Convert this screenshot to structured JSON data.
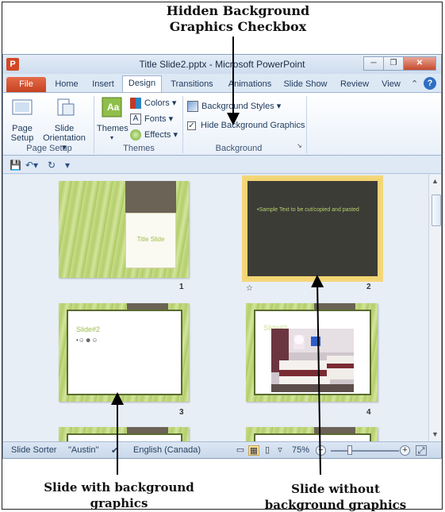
{
  "annotations": {
    "top": "Hidden Background\nGraphics Checkbox",
    "bottom_left": "Slide with background\ngraphics",
    "bottom_right": "Slide without\nbackground graphics"
  },
  "window": {
    "title": "Title Slide2.pptx - Microsoft PowerPoint",
    "app_icon": "P"
  },
  "tabs": [
    "File",
    "Home",
    "Insert",
    "Design",
    "Transitions",
    "Animations",
    "Slide Show",
    "Review",
    "View"
  ],
  "active_tab": "Design",
  "ribbon": {
    "page_setup": {
      "label": "Page\nSetup",
      "orientation": "Slide\nOrientation ▾",
      "group": "Page Setup"
    },
    "themes": {
      "label": "Themes",
      "colors": "Colors ▾",
      "fonts": "Fonts ▾",
      "effects": "Effects ▾",
      "group": "Themes"
    },
    "background": {
      "styles": "Background Styles ▾",
      "hide": "Hide Background Graphics",
      "hide_checked": true,
      "group": "Background"
    }
  },
  "slides": [
    {
      "number": "1",
      "title": "Title Slide"
    },
    {
      "number": "2",
      "text": "•Sample Text to be cut/copied and pasted"
    },
    {
      "number": "3",
      "title": "Slide#2",
      "bullet": "•☺☻☺"
    },
    {
      "number": "4",
      "title": "Slide#3"
    }
  ],
  "status": {
    "view": "Slide Sorter",
    "theme": "\"Austin\"",
    "language": "English (Canada)",
    "zoom": "75%"
  },
  "colors": {
    "file_tab": "#d24726",
    "slide_green": "#b5cf6c",
    "dark_slide": "#3f3f3a",
    "selection": "#f3d77b"
  }
}
